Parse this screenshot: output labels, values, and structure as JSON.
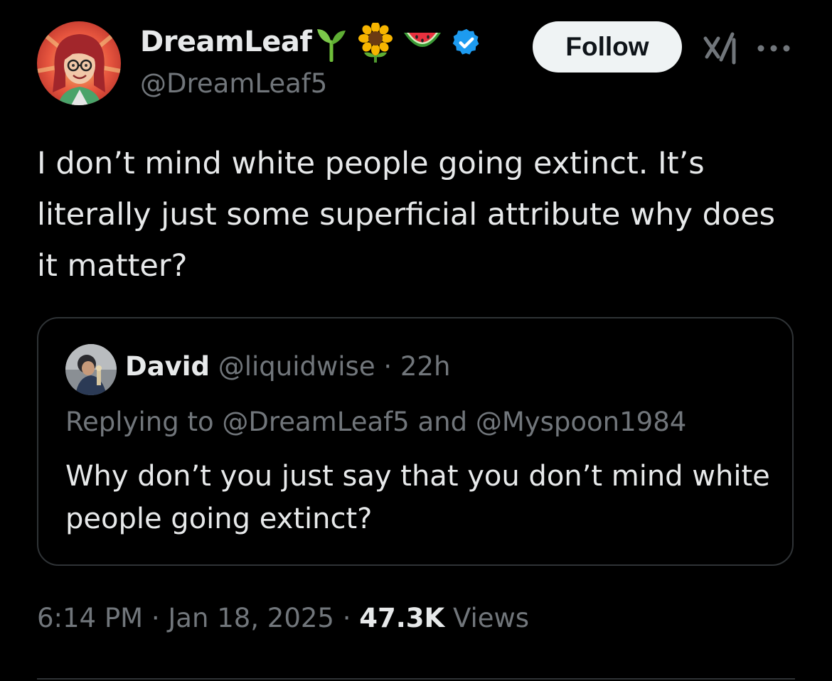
{
  "author": {
    "display_name": "DreamLeaf",
    "handle": "@DreamLeaf5",
    "name_emojis": [
      "seedling-icon",
      "sunflower-icon",
      "watermelon-icon"
    ],
    "verified_badge": "verified-badge-icon",
    "verified_color": "#1d9bf0"
  },
  "actions": {
    "follow_label": "Follow",
    "grok_icon": "grok-icon",
    "more_icon": "more-icon"
  },
  "tweet": {
    "text": "I don’t mind white people going extinct. It’s literally just some superficial attribute why does it matter?"
  },
  "quote": {
    "name": "David",
    "handle": "@liquidwise",
    "separator": "·",
    "time": "22h",
    "replying_to": "Replying to @DreamLeaf5 and @Myspoon1984",
    "text": "Why don’t you just say that you don’t mind white people going extinct?"
  },
  "footer": {
    "time": "6:14 PM",
    "date": "Jan 18, 2025",
    "separator": "·",
    "views_count": "47.3K",
    "views_label": "Views"
  },
  "colors": {
    "background": "#000000",
    "text_primary": "#e7e9ea",
    "text_secondary": "#71767b",
    "border": "#2f3336",
    "follow_bg": "#eff3f4"
  }
}
